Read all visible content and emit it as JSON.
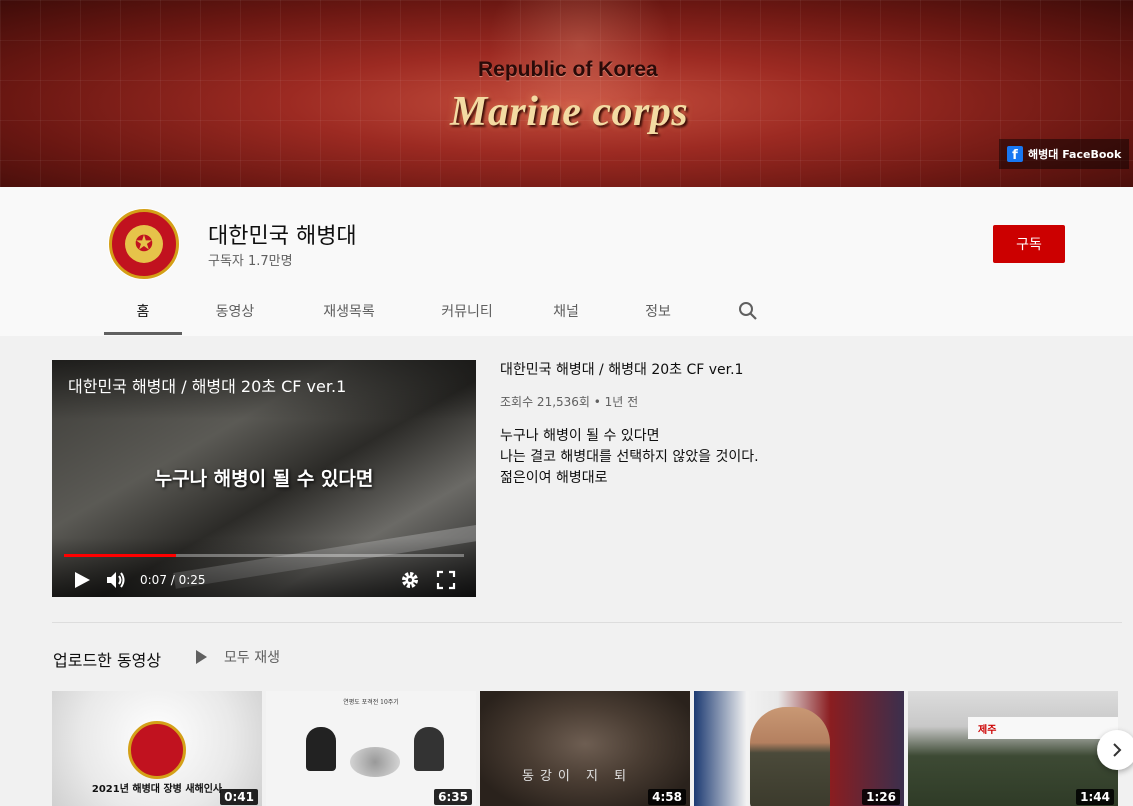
{
  "banner": {
    "subtitle": "Republic of Korea",
    "title": "Marine corps",
    "link_label": "해병대 FaceBook"
  },
  "channel": {
    "name": "대한민국 해병대",
    "subscribers": "구독자 1.7만명",
    "subscribe_label": "구독"
  },
  "tabs": [
    {
      "label": "홈",
      "active": true
    },
    {
      "label": "동영상"
    },
    {
      "label": "재생목록"
    },
    {
      "label": "커뮤니티"
    },
    {
      "label": "채널"
    },
    {
      "label": "정보"
    }
  ],
  "featured": {
    "player_title": "대한민국 해병대 / 해병대 20초 CF ver.1",
    "caption": "누구나 해병이 될 수 있다면",
    "time": "0:07 / 0:25",
    "progress": 0.28,
    "title": "대한민국 해병대 / 해병대 20초 CF ver.1",
    "meta": "조회수 21,536회 • 1년 전",
    "description": [
      "누구나 해병이 될 수 있다면",
      "나는 결코 해병대를 선택하지 않았을 것이다.",
      "젊은이여 해병대로"
    ]
  },
  "uploads": {
    "title": "업로드한 동영상",
    "play_all": "모두 재생",
    "videos": [
      {
        "caption": "2021년 해병대 장병 새해인사",
        "duration": "0:41"
      },
      {
        "caption": "연평도 포격전 10주기",
        "duration": "6:35"
      },
      {
        "caption": "동강이 지 퇴",
        "duration": "4:58"
      },
      {
        "caption": "",
        "duration": "1:26"
      },
      {
        "caption": "제주",
        "duration": "1:44"
      }
    ]
  },
  "colors": {
    "subscribe": "#cc0000",
    "progress": "#ff0000",
    "facebook": "#1877f2"
  }
}
